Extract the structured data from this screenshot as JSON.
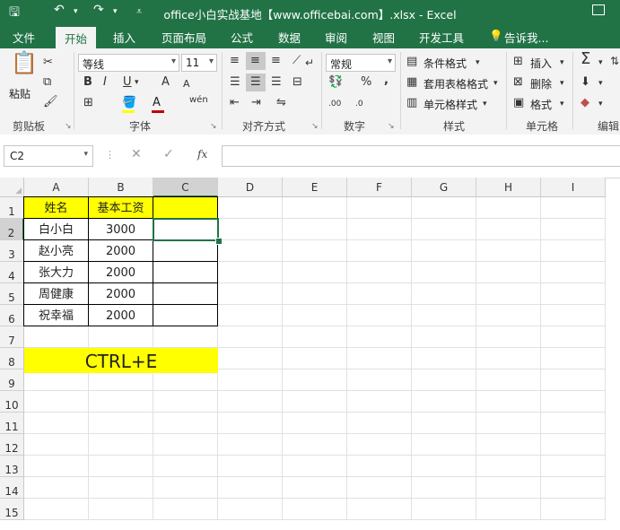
{
  "window": {
    "title": "office小白实战基地【www.officebai.com】.xlsx - Excel"
  },
  "tabs": [
    "文件",
    "开始",
    "插入",
    "页面布局",
    "公式",
    "数据",
    "审阅",
    "视图",
    "开发工具"
  ],
  "tell_me": "告诉我...",
  "ribbon": {
    "clipboard": {
      "paste": "粘贴",
      "label": "剪贴板"
    },
    "font": {
      "name": "等线",
      "size": "11",
      "label": "字体",
      "bold": "B",
      "italic": "I",
      "underline": "U",
      "grow": "A",
      "shrink": "A",
      "font_color": "A",
      "wen": "wén"
    },
    "align": {
      "label": "对齐方式"
    },
    "number": {
      "format": "常规",
      "label": "数字",
      "percent": "%",
      "comma": ",",
      "inc_dec": ".00",
      "dec_dec": ".0"
    },
    "styles": {
      "cond": "条件格式",
      "table": "套用表格格式",
      "cell": "单元格样式",
      "label": "样式"
    },
    "cells": {
      "insert": "插入",
      "delete": "删除",
      "format": "格式",
      "label": "单元格"
    },
    "edit": {
      "label": "编辑"
    }
  },
  "formula_bar": {
    "name_box": "C2",
    "fx": "fx",
    "formula": ""
  },
  "columns": [
    "A",
    "B",
    "C",
    "D",
    "E",
    "F",
    "G",
    "H",
    "I"
  ],
  "rows": [
    "1",
    "2",
    "3",
    "4",
    "5",
    "6",
    "7",
    "8",
    "9",
    "10",
    "11",
    "12",
    "13",
    "14",
    "15"
  ],
  "table": {
    "header": [
      "姓名",
      "基本工资",
      ""
    ],
    "rows": [
      [
        "白小白",
        "3000",
        ""
      ],
      [
        "赵小亮",
        "2000",
        ""
      ],
      [
        "张大力",
        "2000",
        ""
      ],
      [
        "周健康",
        "2000",
        ""
      ],
      [
        "祝幸福",
        "2000",
        ""
      ]
    ]
  },
  "banner": "CTRL+E",
  "colors": {
    "excel_green": "#217346",
    "highlight": "#ffff00",
    "font_red": "#c00000"
  }
}
